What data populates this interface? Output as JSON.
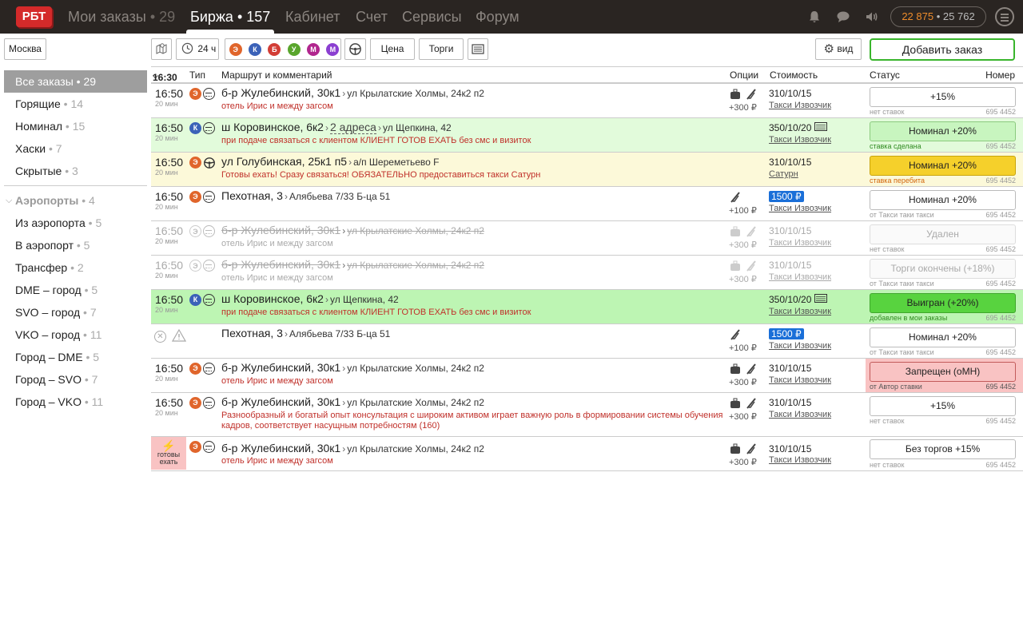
{
  "app": {
    "logo": "РБТ"
  },
  "nav": [
    {
      "label": "Мои заказы",
      "count": "• 29"
    },
    {
      "label": "Биржа",
      "count": "• 157"
    },
    {
      "label": "Кабинет",
      "count": ""
    },
    {
      "label": "Счет",
      "count": ""
    },
    {
      "label": "Сервисы",
      "count": ""
    },
    {
      "label": "Форум",
      "count": ""
    }
  ],
  "balance": {
    "primary": "22 875",
    "sep": "•",
    "secondary": "25 762"
  },
  "toolbar": {
    "city": "Москва",
    "time": "24 ч",
    "price_label": "Цена",
    "trades_label": "Торги",
    "view_label": "вид",
    "add_order": "Добавить заказ",
    "metro": [
      {
        "letter": "Э",
        "color": "#e0652b"
      },
      {
        "letter": "К",
        "color": "#3b62b8"
      },
      {
        "letter": "Б",
        "color": "#d23d35"
      },
      {
        "letter": "У",
        "color": "#59a52c"
      },
      {
        "letter": "М",
        "color": "#b1268e"
      },
      {
        "letter": "М",
        "color": "#8b3fd1"
      }
    ]
  },
  "sidebar": {
    "items": [
      {
        "label": "Все заказы",
        "count": "• 29"
      },
      {
        "label": "Горящие",
        "count": "• 14"
      },
      {
        "label": "Номинал",
        "count": "• 15"
      },
      {
        "label": "Хаски",
        "count": "• 7"
      },
      {
        "label": "Скрытые",
        "count": "• 3"
      }
    ],
    "group": {
      "label": "Аэропорты",
      "count": "• 4"
    },
    "airports": [
      {
        "label": "Из аэропорта",
        "count": "• 5"
      },
      {
        "label": "В аэропорт",
        "count": "• 5"
      },
      {
        "label": "Трансфер",
        "count": "• 2"
      },
      {
        "label": "DME – город",
        "count": "• 5"
      },
      {
        "label": "SVO – город",
        "count": "• 7"
      },
      {
        "label": "VKO – город",
        "count": "• 11"
      },
      {
        "label": "Город – DME",
        "count": "• 5"
      },
      {
        "label": "Город – SVO",
        "count": "• 7"
      },
      {
        "label": "Город – VKO",
        "count": "• 11"
      }
    ]
  },
  "table": {
    "headers": {
      "time": "16:30",
      "type": "Тип",
      "route": "Маршрут и комментарий",
      "options": "Опции",
      "cost": "Стоимость",
      "status": "Статус",
      "number": "Номер"
    },
    "rows": [
      {
        "time": "16:50",
        "min": "20 мин",
        "from": "б-р Жулебинский, 30к1",
        "via": "",
        "to": "ул Крылатские Холмы, 24к2 п2",
        "comment": "отель Ирис и между загсом",
        "price": "+300 ₽",
        "cost": "310/10/15",
        "company": "Такси Извозчик",
        "status": "+15%",
        "note": "нет ставок",
        "number": "695 4452"
      },
      {
        "time": "16:50",
        "min": "20 мин",
        "from": "ш Коровинское, 6к2",
        "via": "2 адреса",
        "to": "ул Щепкина, 42",
        "comment": "при подаче связаться с клиентом КЛИЕНТ ГОТОВ ЕХАТЬ без смс и визиток",
        "price": "",
        "cost": "350/10/20",
        "company": "Такси Извозчик",
        "status": "Номинал +20%",
        "note": "ставка сделана",
        "number": "695 4452"
      },
      {
        "time": "16:50",
        "min": "20 мин",
        "from": "ул Голубинская, 25к1 п5",
        "via": "",
        "to": "а/п Шереметьево F",
        "comment": "Готовы ехать! Сразу связаться! ОБЯЗАТЕЛЬНО предоставиться такси Сатурн",
        "price": "",
        "cost": "310/10/15",
        "company": "Сатурн",
        "status": "Номинал +20%",
        "note": "ставка перебита",
        "number": "695 4452"
      },
      {
        "time": "16:50",
        "min": "20 мин",
        "from": "Пехотная, 3",
        "via": "",
        "to": "Алябьева 7/33 Б-ца 51",
        "comment": "",
        "price": "+100 ₽",
        "cost": "1500 ₽",
        "company": "Такси Извозчик",
        "status": "Номинал +20%",
        "note": "от Такси таки такси",
        "number": "695 4452"
      },
      {
        "time": "16:50",
        "min": "20 мин",
        "from": "б-р Жулебинский, 30к1",
        "via": "",
        "to": "ул Крылатские Холмы, 24к2 п2",
        "comment": "отель Ирис и между загсом",
        "price": "+300 ₽",
        "cost": "310/10/15",
        "company": "Такси Извозчик",
        "status": "Удален",
        "note": "нет ставок",
        "number": "695 4452"
      },
      {
        "time": "16:50",
        "min": "20 мин",
        "from": "б-р Жулебинский, 30к1",
        "via": "",
        "to": "ул Крылатские Холмы, 24к2 п2",
        "comment": "отель Ирис и между загсом",
        "price": "+300 ₽",
        "cost": "310/10/15",
        "company": "Такси Извозчик",
        "status": "Торги окончены (+18%)",
        "note": "от Такси таки такси",
        "number": "695 4452"
      },
      {
        "time": "16:50",
        "min": "20 мин",
        "from": "ш Коровинское, 6к2",
        "via": "",
        "to": "ул Щепкина, 42",
        "comment": "при подаче связаться с клиентом КЛИЕНТ ГОТОВ ЕХАТЬ без смс и визиток",
        "price": "",
        "cost": "350/10/20",
        "company": "Такси Извозчик",
        "status": "Выигран (+20%)",
        "note": "добавлен в мои заказы",
        "number": "695 4452"
      },
      {
        "time": "",
        "min": "",
        "from": "Пехотная, 3",
        "via": "",
        "to": "Алябьева 7/33 Б-ца 51",
        "comment": "",
        "price": "+100 ₽",
        "cost": "1500 ₽",
        "company": "Такси Извозчик",
        "status": "Номинал +20%",
        "note": "от Такси таки такси",
        "number": "695 4452"
      },
      {
        "time": "16:50",
        "min": "20 мин",
        "from": "б-р Жулебинский, 30к1",
        "via": "",
        "to": "ул Крылатские Холмы, 24к2 п2",
        "comment": "отель Ирис и между загсом",
        "price": "+300 ₽",
        "cost": "310/10/15",
        "company": "Такси Извозчик",
        "status": "Запрещен (оМН)",
        "note": "от Автор ставки",
        "number": "695 4452"
      },
      {
        "time": "16:50",
        "min": "20 мин",
        "from": "б-р Жулебинский, 30к1",
        "via": "",
        "to": "ул Крылатские Холмы, 24к2 п2",
        "comment": "Разнообразный и богатый опыт консультация с широким активом играет важную роль в формировании системы обучения",
        "comment2": "кадров, соответствует насущным потребностям (160)",
        "price": "+300 ₽",
        "cost": "310/10/15",
        "company": "Такси Извозчик",
        "status": "+15%",
        "note": "нет ставок",
        "number": "695 4452"
      },
      {
        "time": "",
        "min": "",
        "ready": "готовы",
        "ready2": "ехать",
        "from": "б-р Жулебинский, 30к1",
        "via": "",
        "to": "ул Крылатские Холмы, 24к2 п2",
        "comment": "отель Ирис и между загсом",
        "price": "+300 ₽",
        "cost": "310/10/15",
        "company": "Такси Извозчик",
        "status": "Без торгов +15%",
        "note": "нет ставок",
        "number": "695 4452"
      }
    ]
  }
}
